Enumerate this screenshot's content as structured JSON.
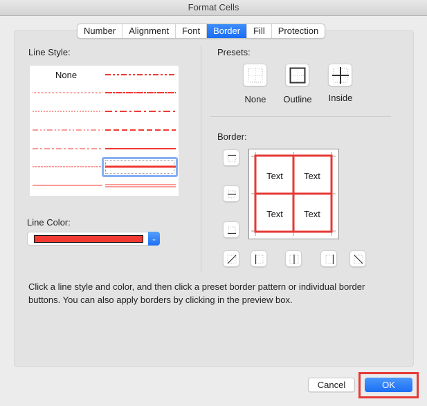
{
  "window": {
    "title": "Format Cells"
  },
  "tabs": [
    {
      "label": "Number",
      "active": false
    },
    {
      "label": "Alignment",
      "active": false
    },
    {
      "label": "Font",
      "active": false
    },
    {
      "label": "Border",
      "active": true
    },
    {
      "label": "Fill",
      "active": false
    },
    {
      "label": "Protection",
      "active": false
    }
  ],
  "line_style": {
    "label": "Line Style:",
    "none_label": "None",
    "selected": "medium-solid",
    "styles_left": [
      "none",
      "hair-dotted",
      "dotted",
      "dash-dot-dot",
      "dash-dot",
      "dashed",
      "thin-solid"
    ],
    "styles_right": [
      "medium-dash-dot-dot",
      "slanted-dash-dot",
      "medium-dash-dot",
      "medium-dashed",
      "medium-solid",
      "thick-solid",
      "double"
    ]
  },
  "line_color": {
    "label": "Line Color:",
    "value": "#f03a33",
    "dropdown_icon": "chevron-down-icon"
  },
  "presets": {
    "label": "Presets:",
    "items": [
      {
        "label": "None",
        "icon": "preset-none-icon"
      },
      {
        "label": "Outline",
        "icon": "preset-outline-icon"
      },
      {
        "label": "Inside",
        "icon": "preset-inside-icon"
      }
    ]
  },
  "border": {
    "label": "Border:",
    "preview_cells": [
      "Text",
      "Text",
      "Text",
      "Text"
    ],
    "border_color": "#e53935",
    "buttons": [
      "border-top-icon",
      "border-middle-horizontal-icon",
      "border-bottom-icon",
      "border-diagonal-up-icon",
      "border-left-icon",
      "border-middle-vertical-icon",
      "border-right-icon",
      "border-diagonal-down-icon"
    ]
  },
  "help_text": "Click a line style and color, and then click a preset border pattern or individual border buttons. You can also apply borders by clicking in the preview box.",
  "footer": {
    "cancel_label": "Cancel",
    "ok_label": "OK"
  },
  "annotation": {
    "highlight_color": "#e53935",
    "target": "ok-button"
  }
}
